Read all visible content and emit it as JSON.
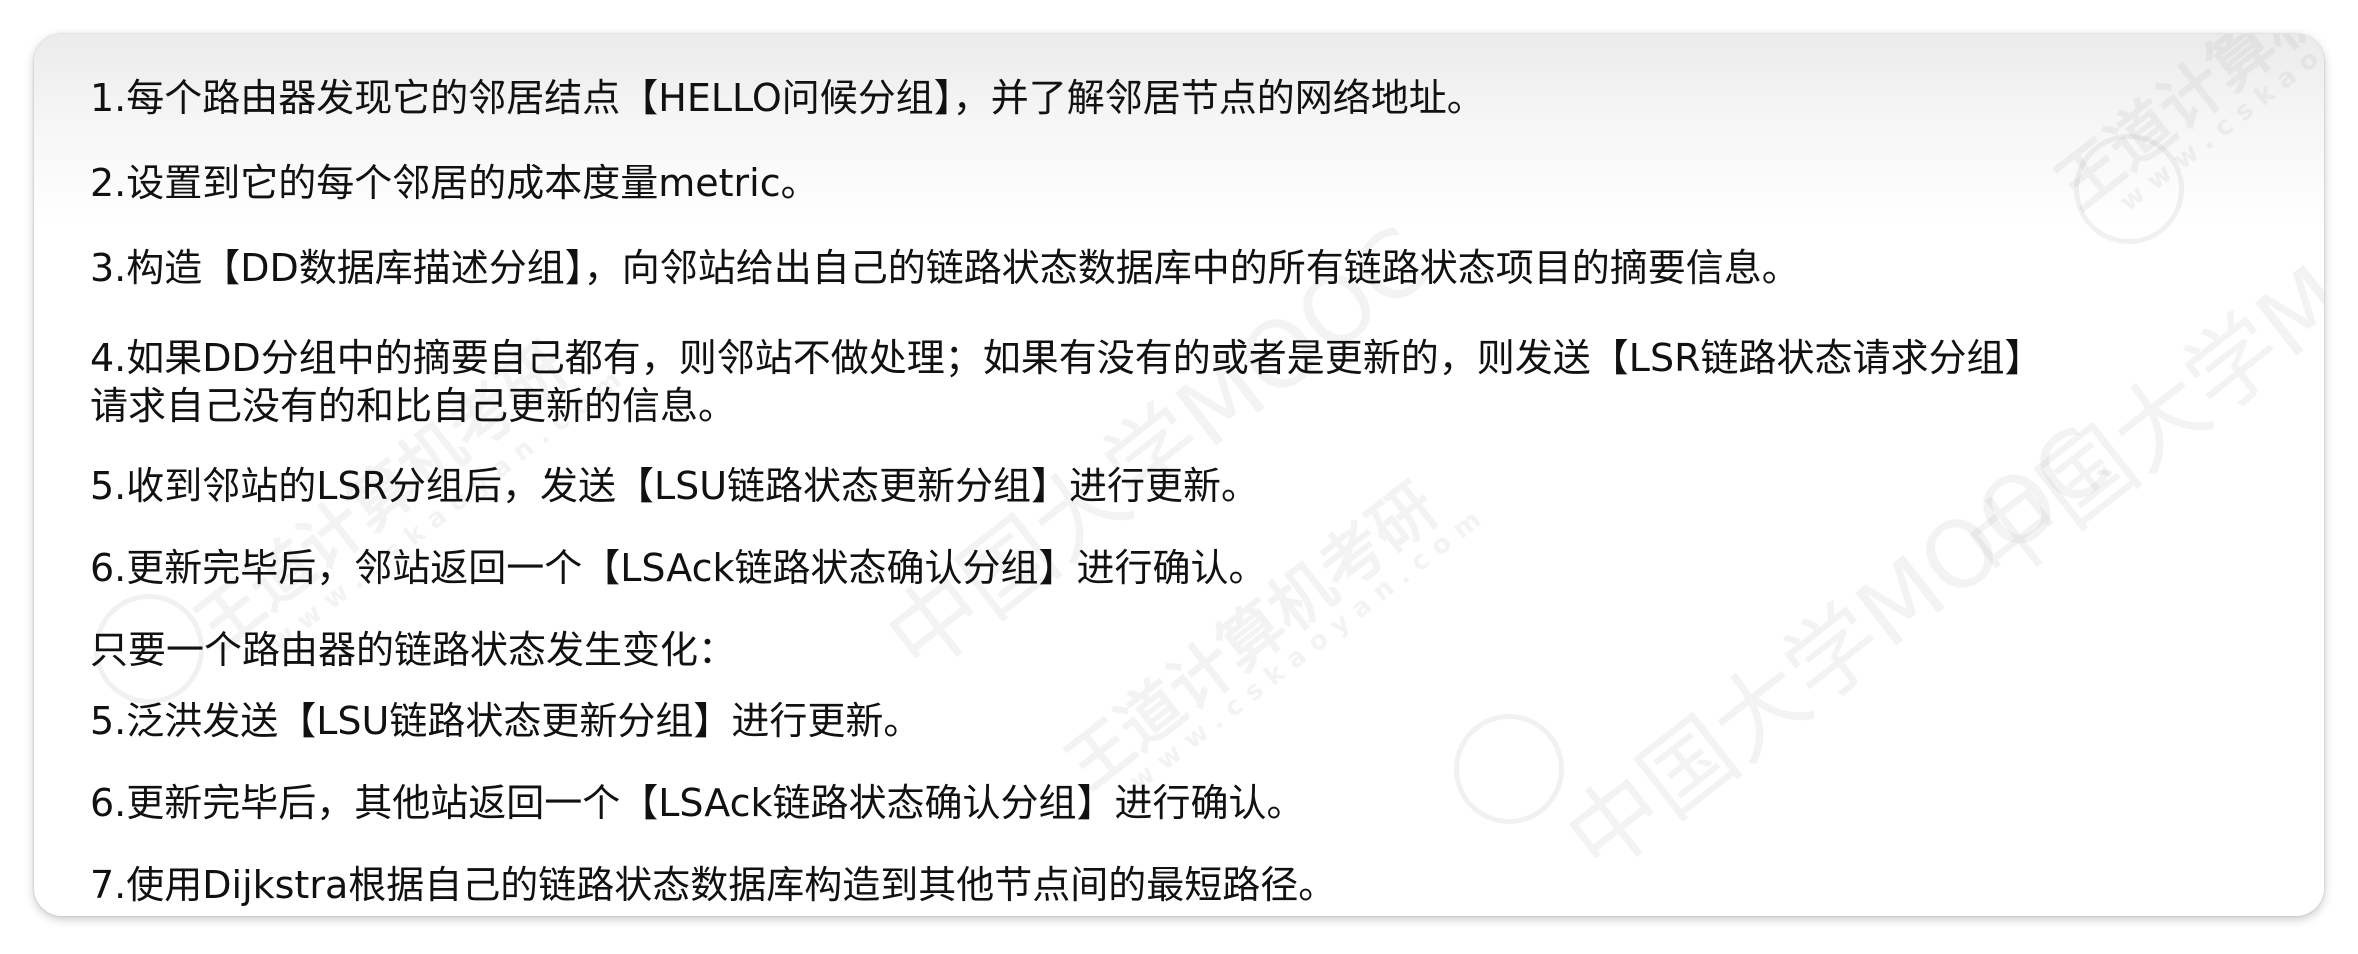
{
  "lines": [
    "1.每个路由器发现它的邻居结点【HELLO问候分组】，并了解邻居节点的网络地址。",
    "2.设置到它的每个邻居的成本度量metric。",
    "3.构造【DD数据库描述分组】，向邻站给出自己的链路状态数据库中的所有链路状态项目的摘要信息。",
    "4.如果DD分组中的摘要自己都有，则邻站不做处理；如果有没有的或者是更新的，则发送【LSR链路状态请求分组】",
    "请求自己没有的和比自己更新的信息。",
    "5.收到邻站的LSR分组后，发送【LSU链路状态更新分组】进行更新。",
    "6.更新完毕后，邻站返回一个【LSAck链路状态确认分组】进行确认。",
    "只要一个路由器的链路状态发生变化：",
    "5.泛洪发送【LSU链路状态更新分组】进行更新。",
    "6.更新完毕后，其他站返回一个【LSAck链路状态确认分组】进行确认。",
    "7.使用Dijkstra根据自己的链路状态数据库构造到其他节点间的最短路径。"
  ],
  "watermark": {
    "brand": "王道计算机考研",
    "url": "www.cskaoyan.com",
    "mooc": "中国大学MOOC"
  }
}
